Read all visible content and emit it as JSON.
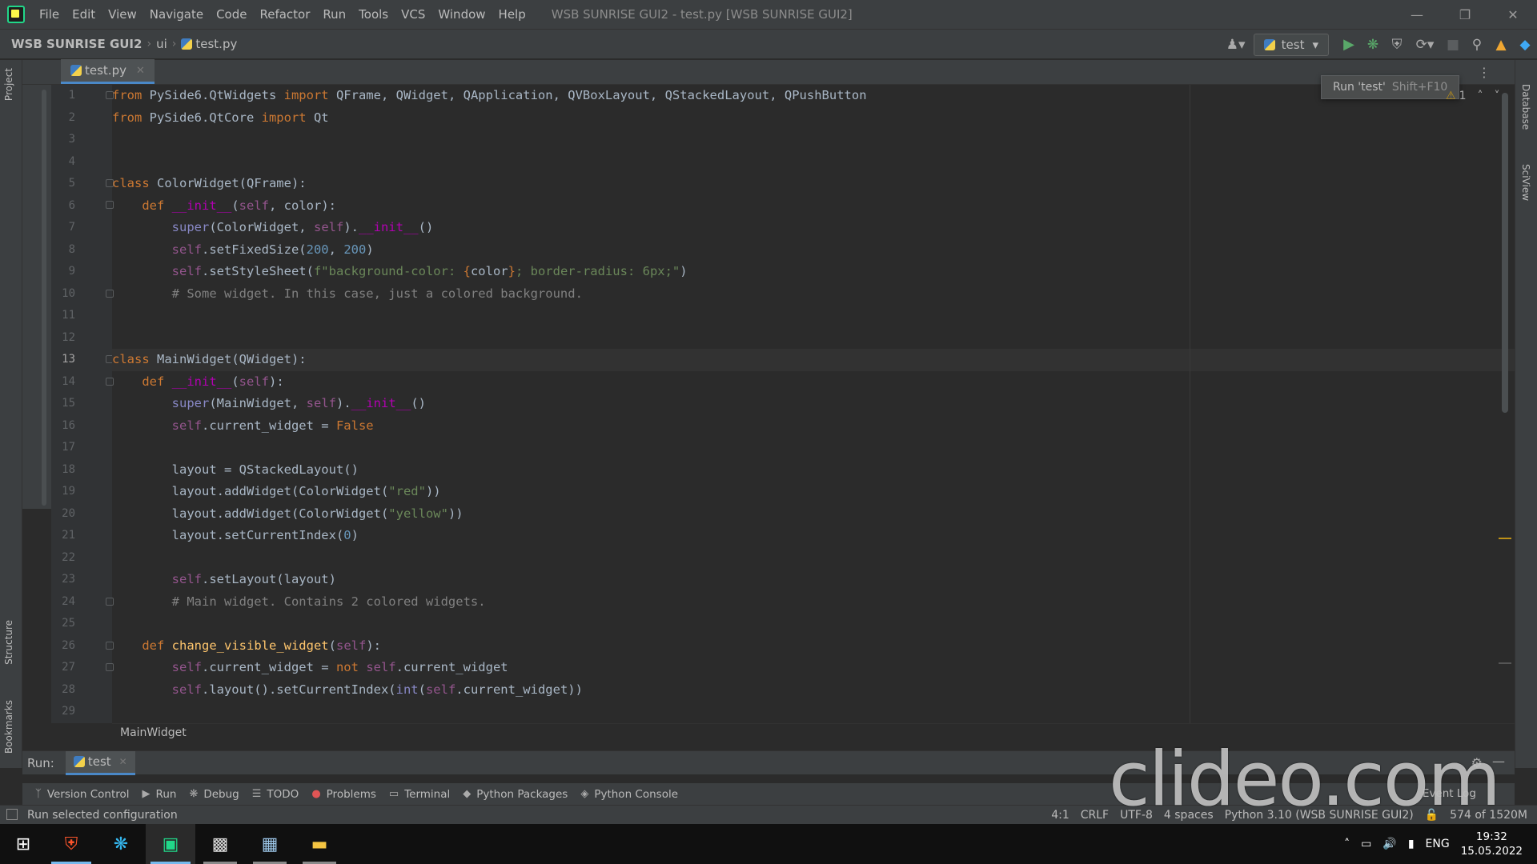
{
  "menubar": {
    "items": [
      "File",
      "Edit",
      "View",
      "Navigate",
      "Code",
      "Refactor",
      "Run",
      "Tools",
      "VCS",
      "Window",
      "Help"
    ],
    "window_title": "WSB SUNRISE GUI2 - test.py [WSB SUNRISE GUI2]"
  },
  "navbar": {
    "project": "WSB SUNRISE GUI2",
    "folder": "ui",
    "file": "test.py",
    "run_config": "test"
  },
  "tooltip": {
    "text": "Run 'test'",
    "shortcut": "Shift+F10"
  },
  "inspection": {
    "warnings": "1"
  },
  "editor": {
    "tab_label": "test.py",
    "breadcrumb": "MainWidget",
    "current_line": 13,
    "line_numbers": [
      "1",
      "2",
      "3",
      "4",
      "5",
      "6",
      "7",
      "8",
      "9",
      "10",
      "11",
      "12",
      "13",
      "14",
      "15",
      "16",
      "17",
      "18",
      "19",
      "20",
      "21",
      "22",
      "23",
      "24",
      "25",
      "26",
      "27",
      "28",
      "29"
    ]
  },
  "left_strip": {
    "project": "Project",
    "structure": "Structure",
    "bookmarks": "Bookmarks"
  },
  "right_strip": {
    "database": "Database",
    "sciview": "SciView"
  },
  "run_panel": {
    "label": "Run:",
    "tab": "test"
  },
  "tool_tabs": [
    "Version Control",
    "Run",
    "Debug",
    "TODO",
    "Problems",
    "Terminal",
    "Python Packages",
    "Python Console"
  ],
  "event_log": "Event Log",
  "status": {
    "message": "Run selected configuration",
    "position": "4:1",
    "line_sep": "CRLF",
    "encoding": "UTF-8",
    "indent": "4 spaces",
    "interpreter": "Python 3.10 (WSB SUNRISE GUI2)",
    "memory": "574 of 1520M"
  },
  "watermark": "clideo.com",
  "taskbar": {
    "language": "ENG",
    "time": "19:32",
    "date": "15.05.2022"
  }
}
